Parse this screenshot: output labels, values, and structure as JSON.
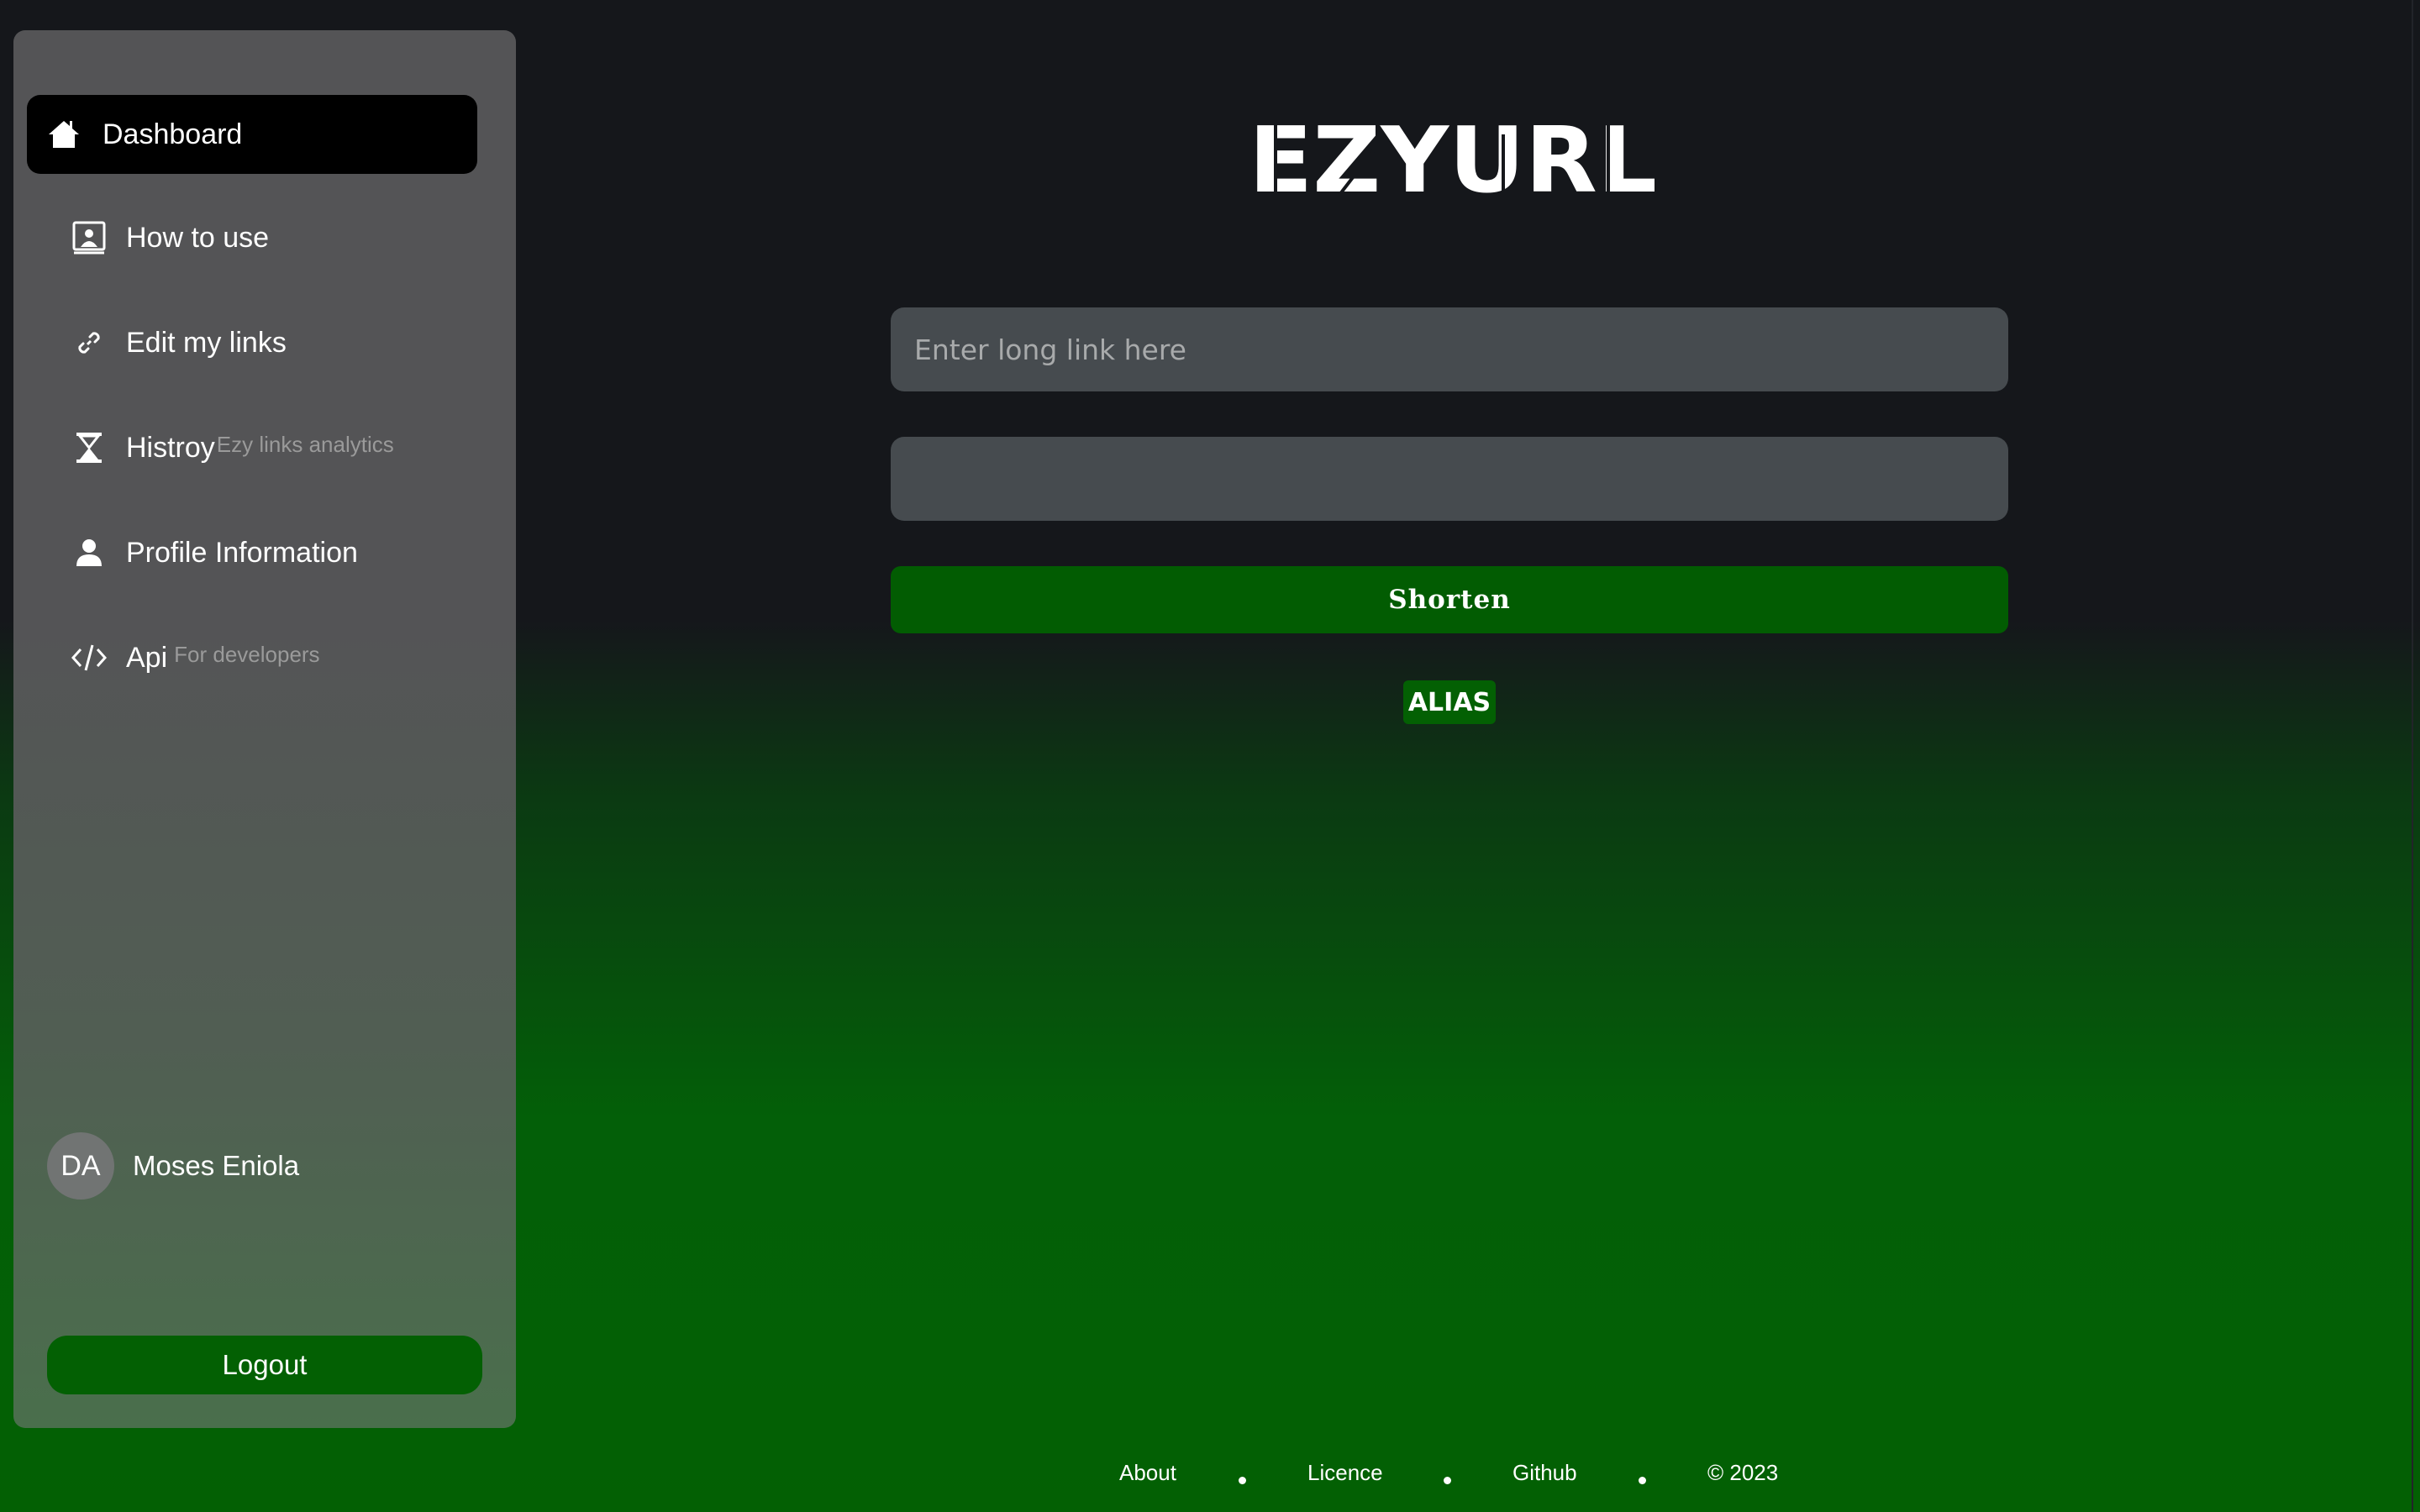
{
  "sidebar": {
    "items": [
      {
        "label": "Dashboard",
        "icon": "home-icon",
        "active": true
      },
      {
        "label": "How to use",
        "icon": "presenter-icon"
      },
      {
        "label": "Edit my links",
        "icon": "link-icon"
      },
      {
        "label": "Histroy",
        "sublabel": "Ezy links analytics",
        "icon": "hourglass-icon"
      },
      {
        "label": "Profile Information",
        "icon": "person-icon"
      },
      {
        "label": "Api",
        "sublabel": "For developers",
        "icon": "code-icon"
      }
    ],
    "user": {
      "initials": "DA",
      "name": "Moses Eniola"
    },
    "logout_label": "Logout"
  },
  "main": {
    "logo_text": "EZYURL",
    "long_link_placeholder": "Enter long link here",
    "long_link_value": "",
    "alias_value": "",
    "shorten_label": "Shorten",
    "alias_toggle_label": "ALIAS"
  },
  "footer": {
    "links": [
      "About",
      "Licence",
      "Github"
    ],
    "copyright": "© 2023"
  },
  "colors": {
    "accent_green": "#036003",
    "sidebar_bg": "#545456",
    "page_bg": "#15171b",
    "input_bg": "#464b4f"
  }
}
